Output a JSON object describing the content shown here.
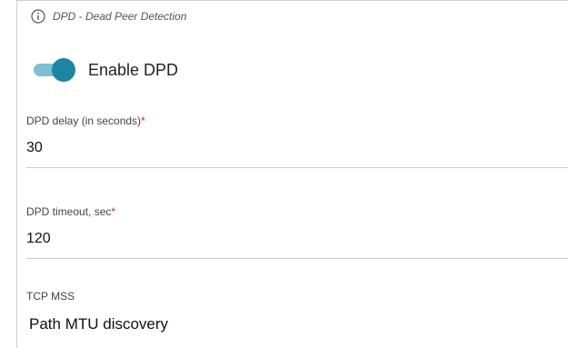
{
  "section": {
    "icon": "info-circle-icon",
    "title": "DPD - Dead Peer Detection"
  },
  "dpd_toggle": {
    "label": "Enable DPD",
    "enabled": true,
    "track_color": "#7fbfd1",
    "knob_color": "#1b85a3"
  },
  "fields": [
    {
      "label": "DPD delay (in seconds)",
      "required_mark": "*",
      "value": "30"
    },
    {
      "label": "DPD timeout, sec",
      "required_mark": "*",
      "value": "120"
    },
    {
      "label": "TCP MSS",
      "value": "Path MTU discovery"
    }
  ],
  "colors": {
    "required": "#d9261c",
    "accent": "#1b85a3"
  }
}
